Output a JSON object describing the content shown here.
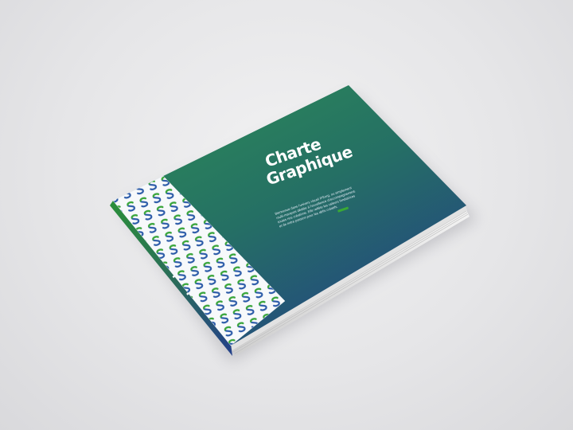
{
  "cover": {
    "title_line1": "Charte",
    "title_line2": "Graphique",
    "body_lines": [
      "Bienvenue dans l'univers visuel IFEorg, ou simplement",
      "multi-marques dédiée à l'excellence d'accompagnement.",
      "toutes nos créations. Elle reflète les valeurs fondatrices",
      "et de notre passion pour les défis créatifs."
    ],
    "accent_color": "#3aa935",
    "gradient_top": "#2c8a58",
    "gradient_bottom": "#244e8a"
  },
  "spine": {
    "title": "Charte Graphique"
  },
  "pattern": {
    "icon": "s-logo-icon",
    "color_green": "#3aa935",
    "color_blue": "#2a5aa8"
  }
}
